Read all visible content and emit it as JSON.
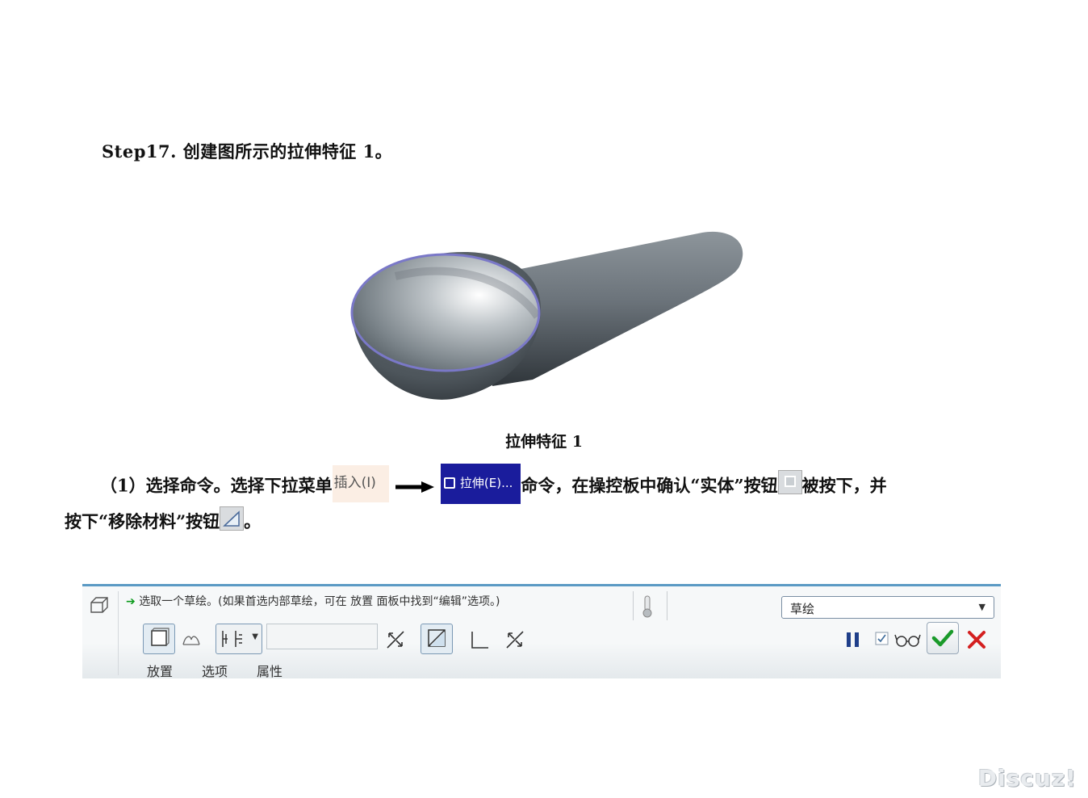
{
  "step_title": "Step17. 创建图所示的拉伸特征 1。",
  "figure_caption": "拉伸特征 1",
  "paragraph": {
    "line1_prefix": "（1）选择命令。选择下拉菜单",
    "menu_insert": "插入(I)",
    "menu_extrude": "拉伸(E)...",
    "line1_middle": "命令，在操控板中确认“实体”按钮",
    "line1_suffix": "被按下，并",
    "line2_prefix": "按下“移除材料”按钮",
    "line2_suffix": "。"
  },
  "toolbar": {
    "prompt": "选取一个草绘。(如果首选内部草绘，可在 放置 面板中找到“编辑”选项。)",
    "dropdown_value": "草绘",
    "tabs": [
      "放置",
      "选项",
      "属性"
    ],
    "depth_value": ""
  },
  "watermark": "Discuz!",
  "colors": {
    "toolbar_border": "#5b9ac4",
    "menu_highlight": "#1a1c9c",
    "ok_green": "#1a9a2a",
    "cancel_red": "#d42020",
    "pause_blue": "#1f3f8a",
    "edge_purple": "#7a78c8"
  },
  "icons": [
    "extrude-feature-icon",
    "prompt-arrow-icon",
    "thermometer-icon",
    "solid-icon",
    "surface-icon",
    "depth-option-icon",
    "flip-direction-icon",
    "remove-material-icon",
    "thicken-icon",
    "flip-material-icon",
    "pause-icon",
    "preview-checkbox-icon",
    "glasses-icon",
    "ok-check-icon",
    "cancel-x-icon"
  ]
}
